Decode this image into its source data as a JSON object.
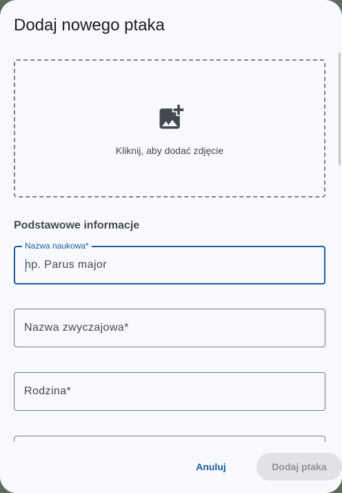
{
  "dialog": {
    "title": "Dodaj nowego ptaka"
  },
  "upload": {
    "icon": "add-photo-icon",
    "text": "Kliknij, aby dodać zdjęcie"
  },
  "section": {
    "title": "Podstawowe informacje"
  },
  "fields": [
    {
      "label": "Nazwa naukowa*",
      "placeholder": "np. Parus major",
      "value": ""
    },
    {
      "label": "Nazwa zwyczajowa*",
      "placeholder": "Nazwa zwyczajowa*",
      "value": ""
    },
    {
      "label": "Rodzina*",
      "placeholder": "Rodzina*",
      "value": ""
    }
  ],
  "footer": {
    "cancel_label": "Anuluj",
    "submit_label": "Dodaj ptaka"
  },
  "colors": {
    "accent": "#1b5b9f",
    "surface": "#f8f9fd",
    "disabled_bg": "#e1e2e7"
  }
}
